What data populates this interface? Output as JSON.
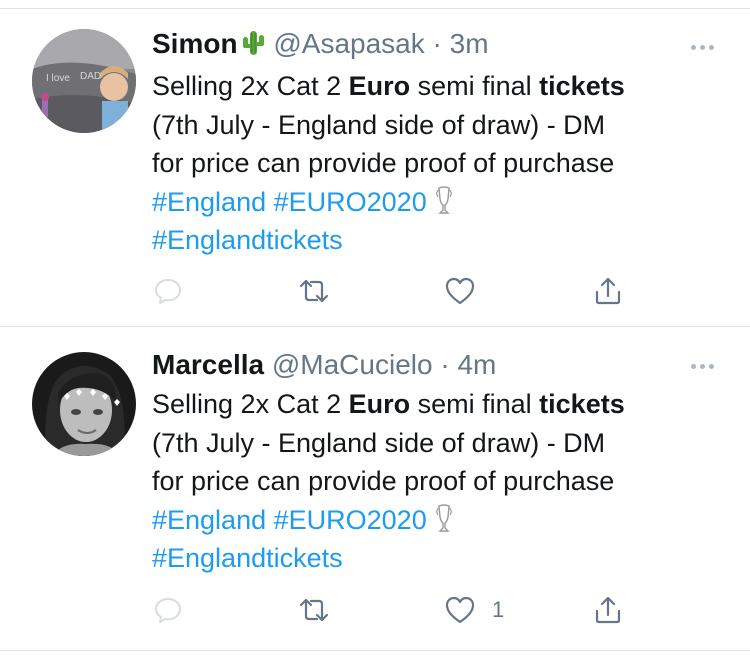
{
  "tweets": [
    {
      "name": "Simon",
      "name_emoji": "cactus-emoji",
      "handle": "@Asapasak",
      "separator": "·",
      "time": "3m",
      "text": {
        "w1": "Selling 2x Cat 2 ",
        "euro": "Euro",
        "w2": " semi final ",
        "tickets": "tickets",
        "w3": "(7th July - England side of draw) - DM",
        "w4": "for price can provide proof of purchase",
        "tag1": "#England",
        "tag2": "#EURO2020",
        "tag3": "#Englandtickets"
      },
      "like_count": ""
    },
    {
      "name": "Marcella",
      "handle": "@MaCucielo",
      "separator": "·",
      "time": "4m",
      "text": {
        "w1": "Selling 2x Cat 2 ",
        "euro": "Euro",
        "w2": " semi final ",
        "tickets": "tickets",
        "w3": "(7th July - England side of draw) - DM",
        "w4": "for price can provide proof of purchase",
        "tag1": "#England",
        "tag2": "#EURO2020",
        "tag3": "#Englandtickets"
      },
      "like_count": "1"
    }
  ],
  "colors": {
    "link": "#1d9bf0",
    "muted": "#657786",
    "icon": "#657786",
    "divider": "#dfe3e6"
  },
  "icons": [
    "reply-icon",
    "retweet-icon",
    "like-icon",
    "share-icon",
    "more-icon",
    "trophy-icon"
  ]
}
